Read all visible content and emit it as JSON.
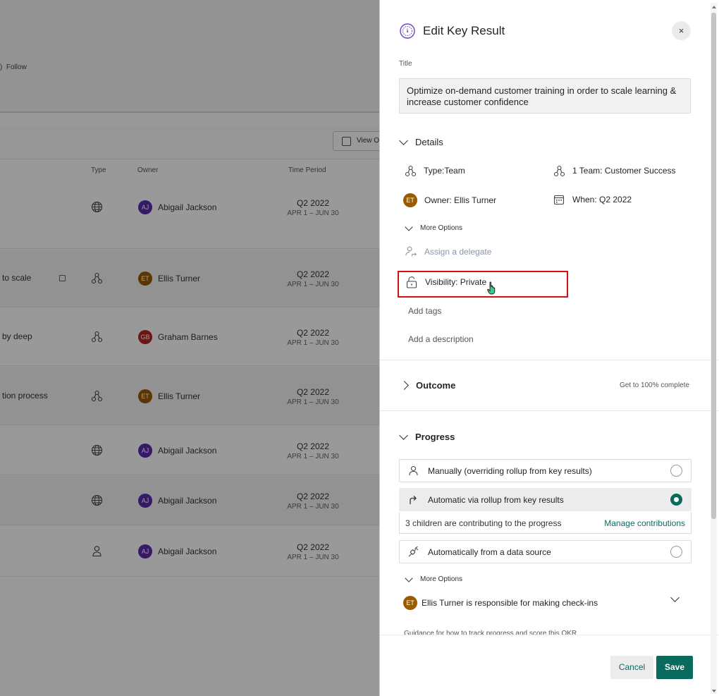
{
  "background": {
    "follow_label": "Follow",
    "view_button_label": "View O",
    "columns": {
      "type": "Type",
      "owner": "Owner",
      "time_period": "Time Period"
    },
    "rows": [
      {
        "title": "",
        "type_icon": "globe-icon",
        "owner": "Abigail Jackson",
        "initials": "AJ",
        "avatar_color": "#5b2bb0",
        "quarter": "Q2 2022",
        "dates": "APR 1 – JUN 30",
        "locked": false
      },
      {
        "title": "to scale",
        "type_icon": "team-icon",
        "owner": "Ellis Turner",
        "initials": "ET",
        "avatar_color": "#9a5b00",
        "quarter": "Q2 2022",
        "dates": "APR 1 – JUN 30",
        "locked": true
      },
      {
        "title": "by deep",
        "type_icon": "team-icon",
        "owner": "Graham Barnes",
        "initials": "GB",
        "avatar_color": "#b3261e",
        "quarter": "Q2 2022",
        "dates": "APR 1 – JUN 30",
        "locked": false
      },
      {
        "title": "tion process",
        "type_icon": "team-icon",
        "owner": "Ellis Turner",
        "initials": "ET",
        "avatar_color": "#9a5b00",
        "quarter": "Q2 2022",
        "dates": "APR 1 – JUN 30",
        "locked": false
      },
      {
        "title": "",
        "type_icon": "globe-icon",
        "owner": "Abigail Jackson",
        "initials": "AJ",
        "avatar_color": "#5b2bb0",
        "quarter": "Q2 2022",
        "dates": "APR 1 – JUN 30",
        "locked": false
      },
      {
        "title": "",
        "type_icon": "globe-icon",
        "owner": "Abigail Jackson",
        "initials": "AJ",
        "avatar_color": "#5b2bb0",
        "quarter": "Q2 2022",
        "dates": "APR 1 – JUN 30",
        "locked": false
      },
      {
        "title": "",
        "type_icon": "person-icon",
        "owner": "Abigail Jackson",
        "initials": "AJ",
        "avatar_color": "#5b2bb0",
        "quarter": "Q2 2022",
        "dates": "APR 1 – JUN 30",
        "locked": false
      }
    ]
  },
  "panel": {
    "heading": "Edit Key Result",
    "close_glyph": "×",
    "title_label": "Title",
    "title_value": "Optimize on-demand customer training in order to scale learning & increase customer confidence",
    "details": {
      "header": "Details",
      "type": "Type:Team",
      "team": "1 Team: Customer Success",
      "owner": "Owner: Ellis Turner",
      "owner_initials": "ET",
      "when": "When: Q2 2022",
      "more_options": "More Options",
      "assign_delegate": "Assign a delegate",
      "visibility": "Visibility: Private",
      "add_tags": "Add tags",
      "add_description": "Add a description"
    },
    "outcome": {
      "header": "Outcome",
      "note": "Get to 100% complete"
    },
    "progress": {
      "header": "Progress",
      "options": [
        {
          "label": "Manually (overriding rollup from key results)",
          "icon": "person-icon",
          "selected": false
        },
        {
          "label": "Automatic via rollup from key results",
          "icon": "arrow-turn-icon",
          "selected": true
        },
        {
          "label": "Automatically from a data source",
          "icon": "plug-icon",
          "selected": false
        }
      ],
      "contrib_text": "3 children are contributing to the progress",
      "manage_link": "Manage contributions",
      "more_options": "More Options",
      "checkins_initials": "ET",
      "checkins_text": "Ellis Turner is responsible for making check-ins",
      "guidance": "Guidance for how to track progress and score this OKR"
    },
    "footer": {
      "cancel": "Cancel",
      "save": "Save"
    },
    "accent_color": "#0b6a5e",
    "highlight_color": "#d80e0e"
  }
}
